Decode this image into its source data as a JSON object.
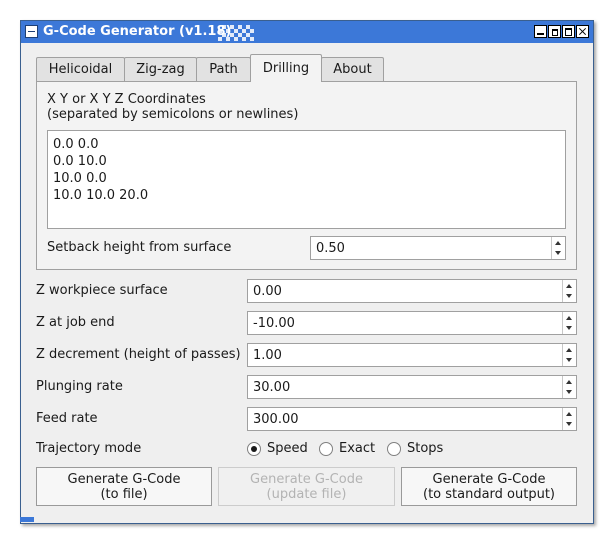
{
  "window": {
    "title": "G-Code Generator (v1.18)"
  },
  "tabs": [
    {
      "label": "Helicoidal"
    },
    {
      "label": "Zig-zag"
    },
    {
      "label": "Path"
    },
    {
      "label": "Drilling",
      "active": true
    },
    {
      "label": "About"
    }
  ],
  "drilling": {
    "coords_label_line1": "X Y or X Y Z Coordinates",
    "coords_label_line2": "(separated by semicolons or newlines)",
    "coords_lines": [
      "0.0 0.0",
      "0.0 10.0",
      "10.0 0.0",
      "10.0 10.0 20.0"
    ],
    "setback_label": "Setback height from surface",
    "setback_value": "0.50"
  },
  "fields": [
    {
      "label": "Z workpiece surface",
      "value": "0.00"
    },
    {
      "label": "Z at job end",
      "value": "-10.00"
    },
    {
      "label": "Z decrement (height of passes)",
      "value": "1.00"
    },
    {
      "label": "Plunging rate",
      "value": "30.00"
    },
    {
      "label": "Feed rate",
      "value": "300.00"
    }
  ],
  "trajectory": {
    "label": "Trajectory mode",
    "options": [
      {
        "label": "Speed",
        "selected": true
      },
      {
        "label": "Exact",
        "selected": false
      },
      {
        "label": "Stops",
        "selected": false
      }
    ]
  },
  "buttons": {
    "gen_file": {
      "line1": "Generate G-Code",
      "line2": "(to file)"
    },
    "gen_update": {
      "line1": "Generate G-Code",
      "line2": "(update file)",
      "disabled": true
    },
    "gen_stdout": {
      "line1": "Generate G-Code",
      "line2": "(to standard output)"
    }
  },
  "colors": {
    "titlebar": "#3c78d8",
    "window_bg": "#efefef"
  }
}
